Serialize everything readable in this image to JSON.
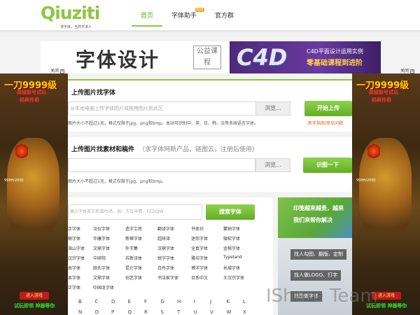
{
  "header": {
    "logo_text": "Qiuziti",
    "logo_tagline": "求字体，当然不求人",
    "nav": [
      {
        "label": "首页",
        "active": true
      },
      {
        "label": "字体助手",
        "badge": "NEW"
      },
      {
        "label": "官方群"
      }
    ]
  },
  "banner": {
    "title": "字体设计",
    "stamp": "公益课程",
    "brand": "C4D",
    "line1": "C4D平面设计运用实例",
    "line2": "零基础课程到进阶"
  },
  "side_ad": {
    "close_label": "关闭",
    "close_icon": "close-icon",
    "title": "一刀9999级",
    "sub1": "高级账号试玩",
    "sub2": "经典传奇",
    "stat": "999H/2000",
    "btn1": "进入游戏",
    "btn2": "进入游戏",
    "bottom": "试玩即领 神器等你"
  },
  "upload1": {
    "title": "上传图片找字体",
    "input_placeholder": "从本地电脑上传字体图片或拖拽图片到此区",
    "browse": "浏览...",
    "submit": "开始上传",
    "note": "图片大小不超过1兆，格式仅限于jpg、png和bmp。本站可识别中、英、日、韩、法等多国语言字体。",
    "help": "新手指南|常见问题"
  },
  "upload2": {
    "title": "上传图片找素材和稿件",
    "hint": "（求字体网新产品，链图云，注册后使用）",
    "input_placeholder": "",
    "browse": "浏览...",
    "submit": "识图一下",
    "note": "图片大小不超过1兆，格式仅限于jpg、png和bmp。"
  },
  "search": {
    "placeholder": "输入字体英文名或PS名，如：方正中倩，FZZQJW",
    "button": "搜索字体"
  },
  "font_list": [
    [
      "方正字体",
      "汉仪字体",
      "造字工房",
      "翻译字体",
      "书体坊",
      "蒙纳字体"
    ],
    [
      "文鼎字体",
      "华康字体",
      "新蒂字体",
      "超研泽",
      "迷你字体",
      "微软字体"
    ],
    [
      "张海山字体",
      "文鼎字体",
      "外字集",
      "汉鼎字体",
      "全真字体",
      "金梧字体"
    ],
    [
      "王汉宗字体",
      "中研院",
      "苏新诗体",
      "锐字字体",
      "雅坊字体",
      "Typeland"
    ],
    [
      "日本字体",
      "田氏字体",
      "昆仑字体",
      "白舟字体",
      "博洋字体",
      "长城字体"
    ],
    [
      "日本字体",
      "文鼎字体",
      "创艺字体",
      "书法家字体",
      "日系中文",
      "王汉宗字体"
    ],
    [
      "方正字体",
      "中国龙字体"
    ]
  ],
  "letters_row1": [
    "B",
    "C",
    "D",
    "E",
    "F",
    "G",
    "H",
    "I",
    "J",
    "K",
    "L"
  ],
  "letters_row2": [
    "N",
    "O",
    "P",
    "Q",
    "R",
    "S",
    "T",
    "U",
    "V",
    "W",
    "X"
  ],
  "promo": {
    "line1": "印笺越来越贵，越来",
    "line2": "我们来帮你解决",
    "btn1": "找人勾图、翻版、定制",
    "btn2": "找人做LOGO、打字",
    "btn3": "找图做字体"
  },
  "watermark": "IShare Team"
}
